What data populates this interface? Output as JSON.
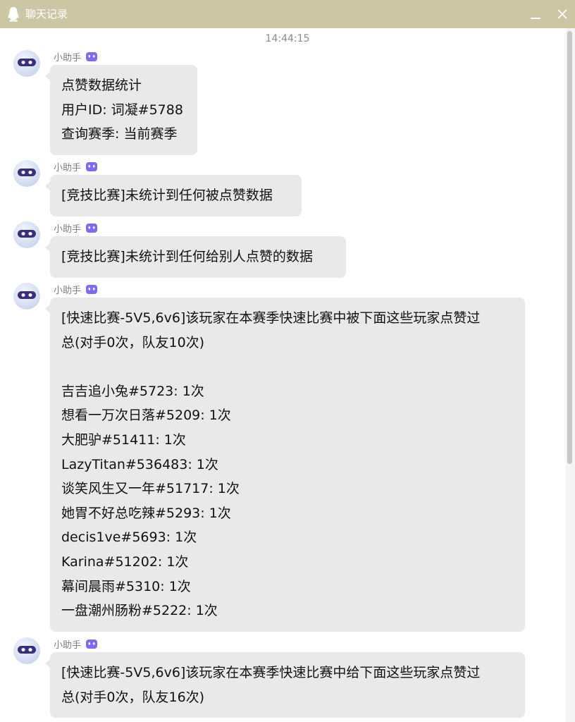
{
  "window": {
    "title": "聊天记录"
  },
  "timestamp": "14:44:15",
  "sender_name": "小助手",
  "messages": [
    {
      "sender": "小助手",
      "lines": [
        "点赞数据统计",
        "用户ID: 词凝#5788",
        "查询赛季: 当前赛季"
      ]
    },
    {
      "sender": "小助手",
      "lines": [
        "[竞技比赛]未统计到任何被点赞数据"
      ]
    },
    {
      "sender": "小助手",
      "lines": [
        "[竞技比赛]未统计到任何给别人点赞的数据"
      ]
    },
    {
      "sender": "小助手",
      "lines": [
        "[快速比赛-5V5,6v6]该玩家在本赛季快速比赛中被下面这些玩家点赞过",
        "总(对手0次，队友10次)",
        "",
        "吉吉追小兔#5723: 1次",
        "想看一万次日落#5209: 1次",
        "大肥驴#51411: 1次",
        "LazyTitan#536483: 1次",
        "谈笑风生又一年#51717: 1次",
        "她胃不好总吃辣#5293: 1次",
        "decis1ve#5693: 1次",
        "Karina#51202: 1次",
        "幕间晨雨#5310: 1次",
        "一盘潮州肠粉#5222: 1次"
      ]
    },
    {
      "sender": "小助手",
      "lines": [
        "[快速比赛-5V5,6v6]该玩家在本赛季快速比赛中给下面这些玩家点赞过",
        "总(对手0次，队友16次)"
      ]
    }
  ],
  "colors": {
    "titlebar": "#cdc6a4",
    "bubble": "#e9e9e9",
    "badge": "#7b6cf6",
    "avatar_visor": "#3b2f7a"
  },
  "icons": {
    "app": "penguin-icon",
    "minimize": "minimize-icon",
    "close": "close-icon",
    "avatar": "robot-avatar",
    "badge": "bot-badge-icon"
  }
}
